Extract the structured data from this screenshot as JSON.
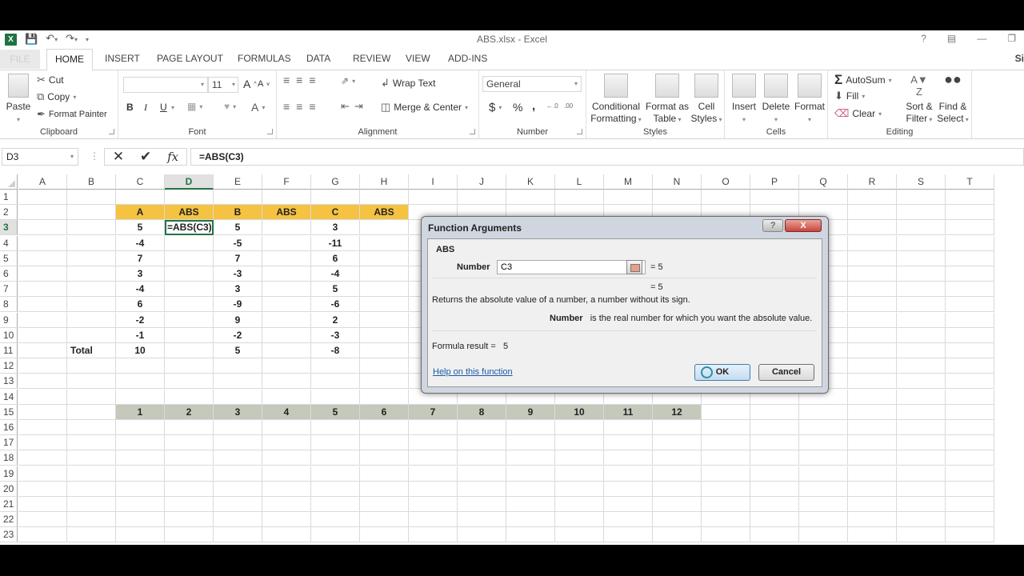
{
  "window": {
    "title": "ABS.xlsx - Excel",
    "controls": [
      "?",
      "ribbon-display",
      "minimize",
      "restore"
    ],
    "signin_partial": "Si"
  },
  "quick_access": [
    "excel-logo",
    "save-icon",
    "undo-icon",
    "redo-icon",
    "customize-icon"
  ],
  "tabs": [
    {
      "label": "FILE"
    },
    {
      "label": "HOME",
      "active": true
    },
    {
      "label": "INSERT"
    },
    {
      "label": "PAGE LAYOUT"
    },
    {
      "label": "FORMULAS"
    },
    {
      "label": "DATA"
    },
    {
      "label": "REVIEW"
    },
    {
      "label": "VIEW"
    },
    {
      "label": "ADD-INS"
    }
  ],
  "ribbon": {
    "clipboard": {
      "label": "Clipboard",
      "paste": "Paste",
      "cut": "Cut",
      "copy": "Copy",
      "format_painter": "Format Painter"
    },
    "font": {
      "label": "Font",
      "font_name": "",
      "font_size": "11",
      "bold": "B",
      "italic": "I",
      "underline": "U"
    },
    "alignment": {
      "label": "Alignment",
      "wrap_text": "Wrap Text",
      "merge_center": "Merge & Center"
    },
    "number": {
      "label": "Number",
      "format": "General",
      "currency": "$",
      "percent": "%",
      "comma": ","
    },
    "styles": {
      "label": "Styles",
      "conditional": [
        "Conditional",
        "Formatting"
      ],
      "format_table": [
        "Format as",
        "Table"
      ],
      "cell_styles": [
        "Cell",
        "Styles"
      ]
    },
    "cells": {
      "label": "Cells",
      "insert": "Insert",
      "delete": "Delete",
      "format": "Format"
    },
    "editing": {
      "label": "Editing",
      "autosum": "AutoSum",
      "fill": "Fill",
      "clear": "Clear",
      "sort_filter": [
        "Sort &",
        "Filter"
      ],
      "find_select": [
        "Find &",
        "Select"
      ]
    }
  },
  "formula_bar": {
    "name_box": "D3",
    "formula": "=ABS(C3)"
  },
  "columns": [
    "A",
    "B",
    "C",
    "D",
    "E",
    "F",
    "G",
    "H",
    "I",
    "J",
    "K",
    "L",
    "M",
    "N",
    "O",
    "P",
    "Q",
    "R",
    "S",
    "T"
  ],
  "selected_column": "D",
  "selected_row": 3,
  "rows": [
    "1",
    "2",
    "3",
    "4",
    "5",
    "6",
    "7",
    "8",
    "9",
    "10",
    "11",
    "12",
    "13",
    "14",
    "15",
    "16",
    "17",
    "18",
    "19",
    "20",
    "21",
    "22",
    "23"
  ],
  "sheet": {
    "header_row": {
      "row": 2,
      "cells": {
        "C": "A",
        "D": "ABS",
        "E": "B",
        "F": "ABS",
        "G": "C",
        "H": "ABS"
      }
    },
    "data": [
      {
        "row": 3,
        "C": "5",
        "D": "=ABS(C3)",
        "E": "5",
        "G": "3"
      },
      {
        "row": 4,
        "C": "-4",
        "E": "-5",
        "G": "-11"
      },
      {
        "row": 5,
        "C": "7",
        "E": "7",
        "G": "6"
      },
      {
        "row": 6,
        "C": "3",
        "E": "-3",
        "G": "-4"
      },
      {
        "row": 7,
        "C": "-4",
        "E": "3",
        "G": "5"
      },
      {
        "row": 8,
        "C": "6",
        "E": "-9",
        "G": "-6"
      },
      {
        "row": 9,
        "C": "-2",
        "E": "9",
        "G": "2"
      },
      {
        "row": 10,
        "C": "-1",
        "E": "-2",
        "G": "-3"
      },
      {
        "row": 11,
        "B": "Total",
        "C": "10",
        "E": "5",
        "G": "-8"
      }
    ],
    "number_row": {
      "row": 15,
      "values": [
        "1",
        "2",
        "3",
        "4",
        "5",
        "6",
        "7",
        "8",
        "9",
        "10",
        "11",
        "12"
      ]
    },
    "colors": {
      "header_fill": "#f5c242",
      "number_row_fill": "#c4c9bc",
      "selection": "#217346"
    }
  },
  "dialog": {
    "title": "Function Arguments",
    "function_name": "ABS",
    "arg_label": "Number",
    "arg_value": "C3",
    "arg_result": "=  5",
    "func_result": "=  5",
    "description": "Returns the absolute value of a number, a number without its sign.",
    "arg_desc_label": "Number",
    "arg_desc": "is the real number for which you want the absolute value.",
    "formula_result_label": "Formula result =",
    "formula_result": "5",
    "help_link": "Help on this function",
    "ok": "OK",
    "cancel": "Cancel",
    "help_btn": "?",
    "close_btn": "X"
  }
}
